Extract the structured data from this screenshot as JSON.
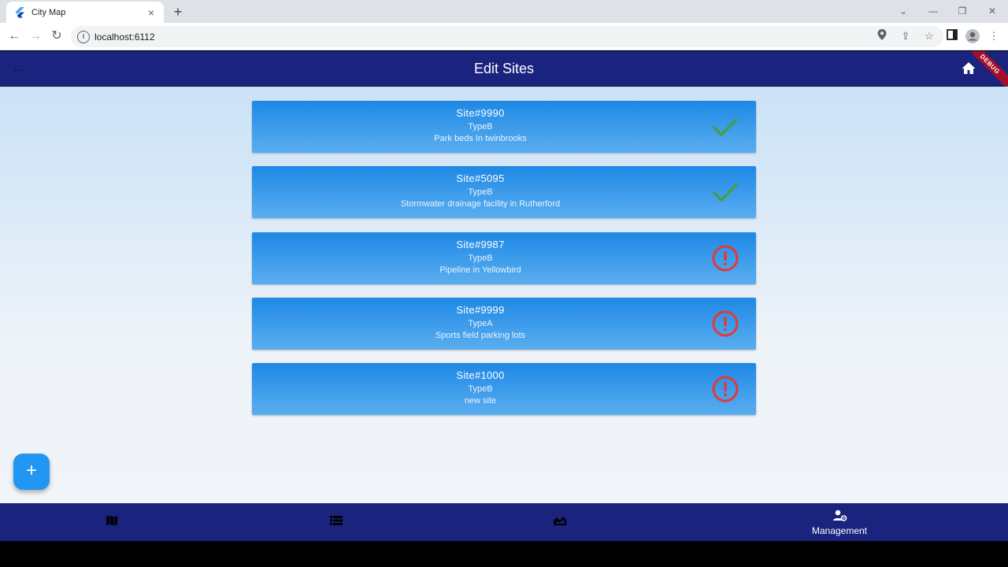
{
  "browser": {
    "tab_title": "City Map",
    "url": "localhost:6112"
  },
  "appbar": {
    "title": "Edit Sites",
    "debug_banner": "DEBUG"
  },
  "sites": [
    {
      "name": "Site#9990",
      "type": "TypeB",
      "description": "Park beds In twinbrooks",
      "status": "ok"
    },
    {
      "name": "Site#5095",
      "type": "TypeB",
      "description": "Stormwater drainage facility in Rutherford",
      "status": "ok"
    },
    {
      "name": "Site#9987",
      "type": "TypeB",
      "description": "Pipeline in Yellowbird",
      "status": "error"
    },
    {
      "name": "Site#9999",
      "type": "TypeA",
      "description": "Sports field parking lots",
      "status": "error"
    },
    {
      "name": "Site#1000",
      "type": "TypeB",
      "description": "new site",
      "status": "error"
    }
  ],
  "bottom_nav": {
    "items": [
      {
        "icon": "map-icon",
        "label": ""
      },
      {
        "icon": "list-icon",
        "label": ""
      },
      {
        "icon": "landscape-icon",
        "label": ""
      },
      {
        "icon": "manage-accounts-icon",
        "label": "Management"
      }
    ],
    "selected_index": 3
  },
  "colors": {
    "appbar": "#1a237e",
    "card": "#1e88e5",
    "ok": "#43a047",
    "error": "#e53935",
    "fab": "#2196f3"
  }
}
